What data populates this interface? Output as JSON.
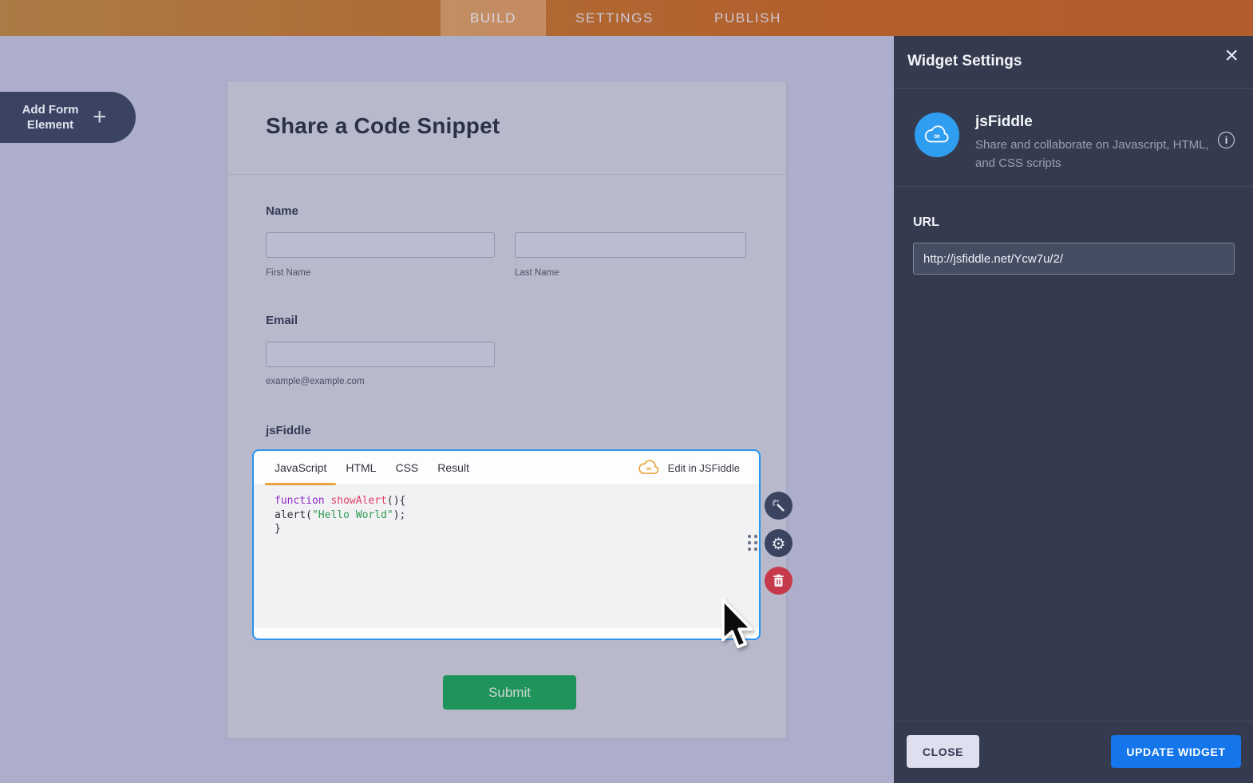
{
  "topbar": {
    "tabs": [
      {
        "label": "BUILD",
        "active": true
      },
      {
        "label": "SETTINGS",
        "active": false
      },
      {
        "label": "PUBLISH",
        "active": false
      }
    ]
  },
  "sidebar": {
    "add_button_label": "Add Form Element"
  },
  "form": {
    "title": "Share a Code Snippet",
    "name_field": {
      "label": "Name",
      "first_value": "",
      "first_sublabel": "First Name",
      "last_value": "",
      "last_sublabel": "Last Name"
    },
    "email_field": {
      "label": "Email",
      "value": "",
      "sublabel": "example@example.com"
    },
    "widget_field": {
      "label": "jsFiddle",
      "tabs": [
        "JavaScript",
        "HTML",
        "CSS",
        "Result"
      ],
      "active_tab": "JavaScript",
      "edit_link": "Edit in JSFiddle",
      "code_lines": [
        {
          "keyword": "function",
          "name": " showAlert",
          "punct": "(){"
        },
        {
          "pre": "alert(",
          "string": "\"Hello World\"",
          "post": ");"
        },
        {
          "punct": "}"
        }
      ]
    },
    "submit_label": "Submit"
  },
  "panel": {
    "title": "Widget Settings",
    "widget": {
      "name": "jsFiddle",
      "description": "Share and collaborate on Javascript, HTML, and CSS scripts"
    },
    "url": {
      "label": "URL",
      "value": "http://jsfiddle.net/Ycw7u/2/"
    },
    "footer": {
      "close_label": "CLOSE",
      "update_label": "UPDATE WIDGET"
    }
  },
  "icons": {
    "plus": "+",
    "close": "×",
    "gear": "⚙",
    "infinity": "∞",
    "info": "i"
  },
  "colors": {
    "topbar_orange": "#b3682f",
    "accent_orange": "#e8a33d",
    "widget_border_blue": "#2a94ee",
    "jsfiddle_blue": "#2f9ef0",
    "update_blue": "#1576eb",
    "submit_green": "#1f945a",
    "delete_red": "#c6394a",
    "panel_bg": "#353b4f",
    "canvas_bg": "#acaecb",
    "code_keyword": "#9027c5",
    "code_function_name": "#e0436a",
    "code_string": "#2f9c51"
  }
}
